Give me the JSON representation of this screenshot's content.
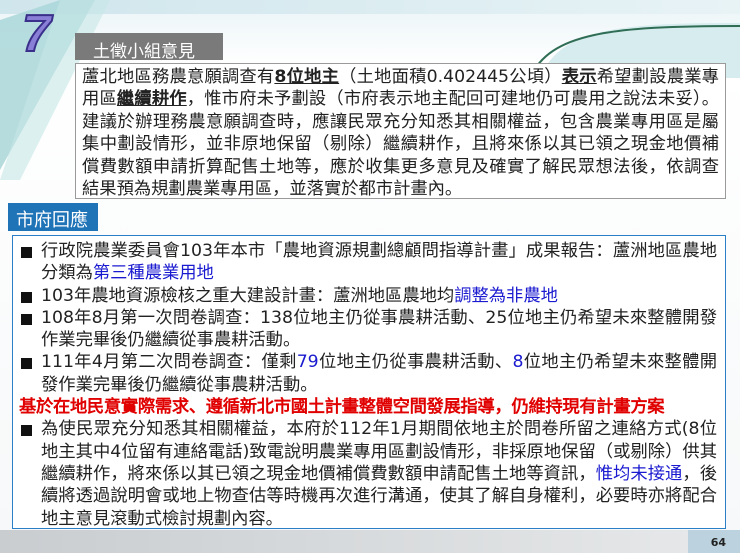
{
  "slide_number_badge": "7",
  "opinion_section": {
    "label": "土徵小組意見",
    "segments": [
      {
        "t": "蘆北地區務農意願調查有",
        "s": ""
      },
      {
        "t": "8位地主",
        "s": "u"
      },
      {
        "t": "（土地面積0.402445公頃）",
        "s": ""
      },
      {
        "t": "表示",
        "s": "u"
      },
      {
        "t": "希望劃設農業專用區",
        "s": ""
      },
      {
        "t": "繼續耕作",
        "s": "u"
      },
      {
        "t": "，惟市府未予劃設（市府表示地主配回可建地仍可農用之說法未妥）。建議於辦理務農意願調查時，應讓民眾充分知悉其相關權益，包含農業專用區是屬集中劃設情形，並非原地保留（剔除）繼續耕作，且將來係以其已領之現金地價補償費數額申請折算配售土地等，應於收集更多意見及確實了解民眾想法後，依調查結果預為規劃農業專用區，並落實於都市計畫內。",
        "s": ""
      }
    ]
  },
  "response_section": {
    "label": "市府回應",
    "items": [
      {
        "type": "bullet",
        "segments": [
          {
            "t": "行政院農業委員會103年本市「農地資源規劃總顧問指導計畫」成果報告：蘆洲地區農地分類為",
            "s": ""
          },
          {
            "t": "第三種農業用地",
            "s": "blue"
          }
        ]
      },
      {
        "type": "bullet",
        "segments": [
          {
            "t": "103年農地資源檢核之重大建設計畫：蘆洲地區農地均",
            "s": ""
          },
          {
            "t": "調整為非農地",
            "s": "blue"
          }
        ]
      },
      {
        "type": "bullet",
        "segments": [
          {
            "t": "108年8月第一次問卷調查：138位地主仍從事農耕活動、25位地主仍希望未來整體開發作業完畢後仍繼續從事農耕活動。",
            "s": ""
          }
        ]
      },
      {
        "type": "bullet",
        "segments": [
          {
            "t": "111年4月第二次問卷調查：僅剩",
            "s": ""
          },
          {
            "t": "79",
            "s": "blue"
          },
          {
            "t": "位地主仍從事農耕活動、",
            "s": ""
          },
          {
            "t": "8",
            "s": "blue"
          },
          {
            "t": "位地主仍希望未來整體開發作業完畢後仍繼續從事農耕活動。",
            "s": ""
          }
        ]
      },
      {
        "type": "highlight",
        "segments": [
          {
            "t": "基於在地民意實際需求、遵循新北市國土計畫整體空間發展指導，仍維持現有計畫方案",
            "s": "red"
          }
        ]
      },
      {
        "type": "bullet",
        "segments": [
          {
            "t": "為使民眾充分知悉其相關權益，本府於112年1月期間依地主於問卷所留之連絡方式(8位地主其中4位留有連絡電話)致電說明農業專用區劃設情形，非採原地保留（或剔除）供其繼續耕作，將來係以其已領之現金地價補償費數額申請配售土地等資訊，",
            "s": ""
          },
          {
            "t": "惟均未接通",
            "s": "blue"
          },
          {
            "t": "，後續將透過說明會或地上物查估等時機再次進行溝通，使其了解自身權利，必要時亦將配合地主意見滾動式檢討規劃內容。",
            "s": ""
          }
        ]
      }
    ]
  },
  "page_number": "64",
  "colors": {
    "accent_blue": "#1f73b7",
    "highlight_red": "#e00000",
    "link_blue": "#1a1ad0",
    "label_gray": "#7a7a7a"
  }
}
